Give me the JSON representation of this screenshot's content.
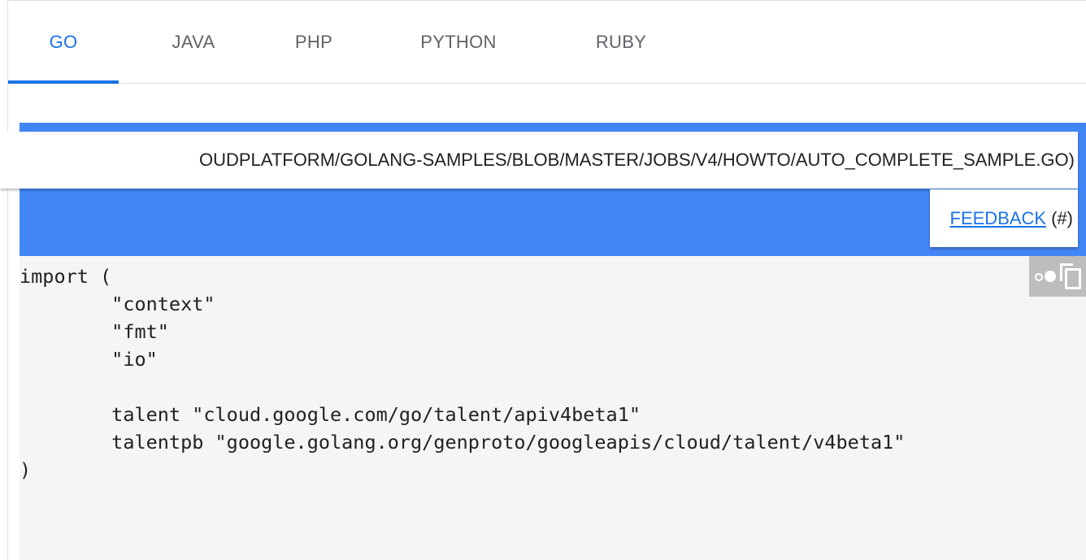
{
  "tabs": [
    {
      "label": "GO",
      "active": true
    },
    {
      "label": "JAVA",
      "active": false
    },
    {
      "label": "PHP",
      "active": false
    },
    {
      "label": "PYTHON",
      "active": false
    },
    {
      "label": "RUBY",
      "active": false
    }
  ],
  "banner": {
    "source_url_text": "OUDPLATFORM/GOLANG-SAMPLES/BLOB/MASTER/JOBS/V4/HOWTO/AUTO_COMPLETE_SAMPLE.GO)",
    "feedback_label": "FEEDBACK",
    "feedback_suffix": "(#)"
  },
  "code": {
    "language": "go",
    "content": "import (\n        \"context\"\n        \"fmt\"\n        \"io\"\n\n        talent \"cloud.google.com/go/talent/apiv4beta1\"\n        talentpb \"google.golang.org/genproto/googleapis/cloud/talent/v4beta1\"\n)"
  },
  "code_toolbar": {
    "icons": [
      "dark-theme-toggle-icon",
      "copy-icon"
    ]
  },
  "colors": {
    "accent": "#1a73e8",
    "banner": "#4285f4",
    "code_background": "#f5f5f5",
    "toolbar": "#bdbdbd"
  }
}
